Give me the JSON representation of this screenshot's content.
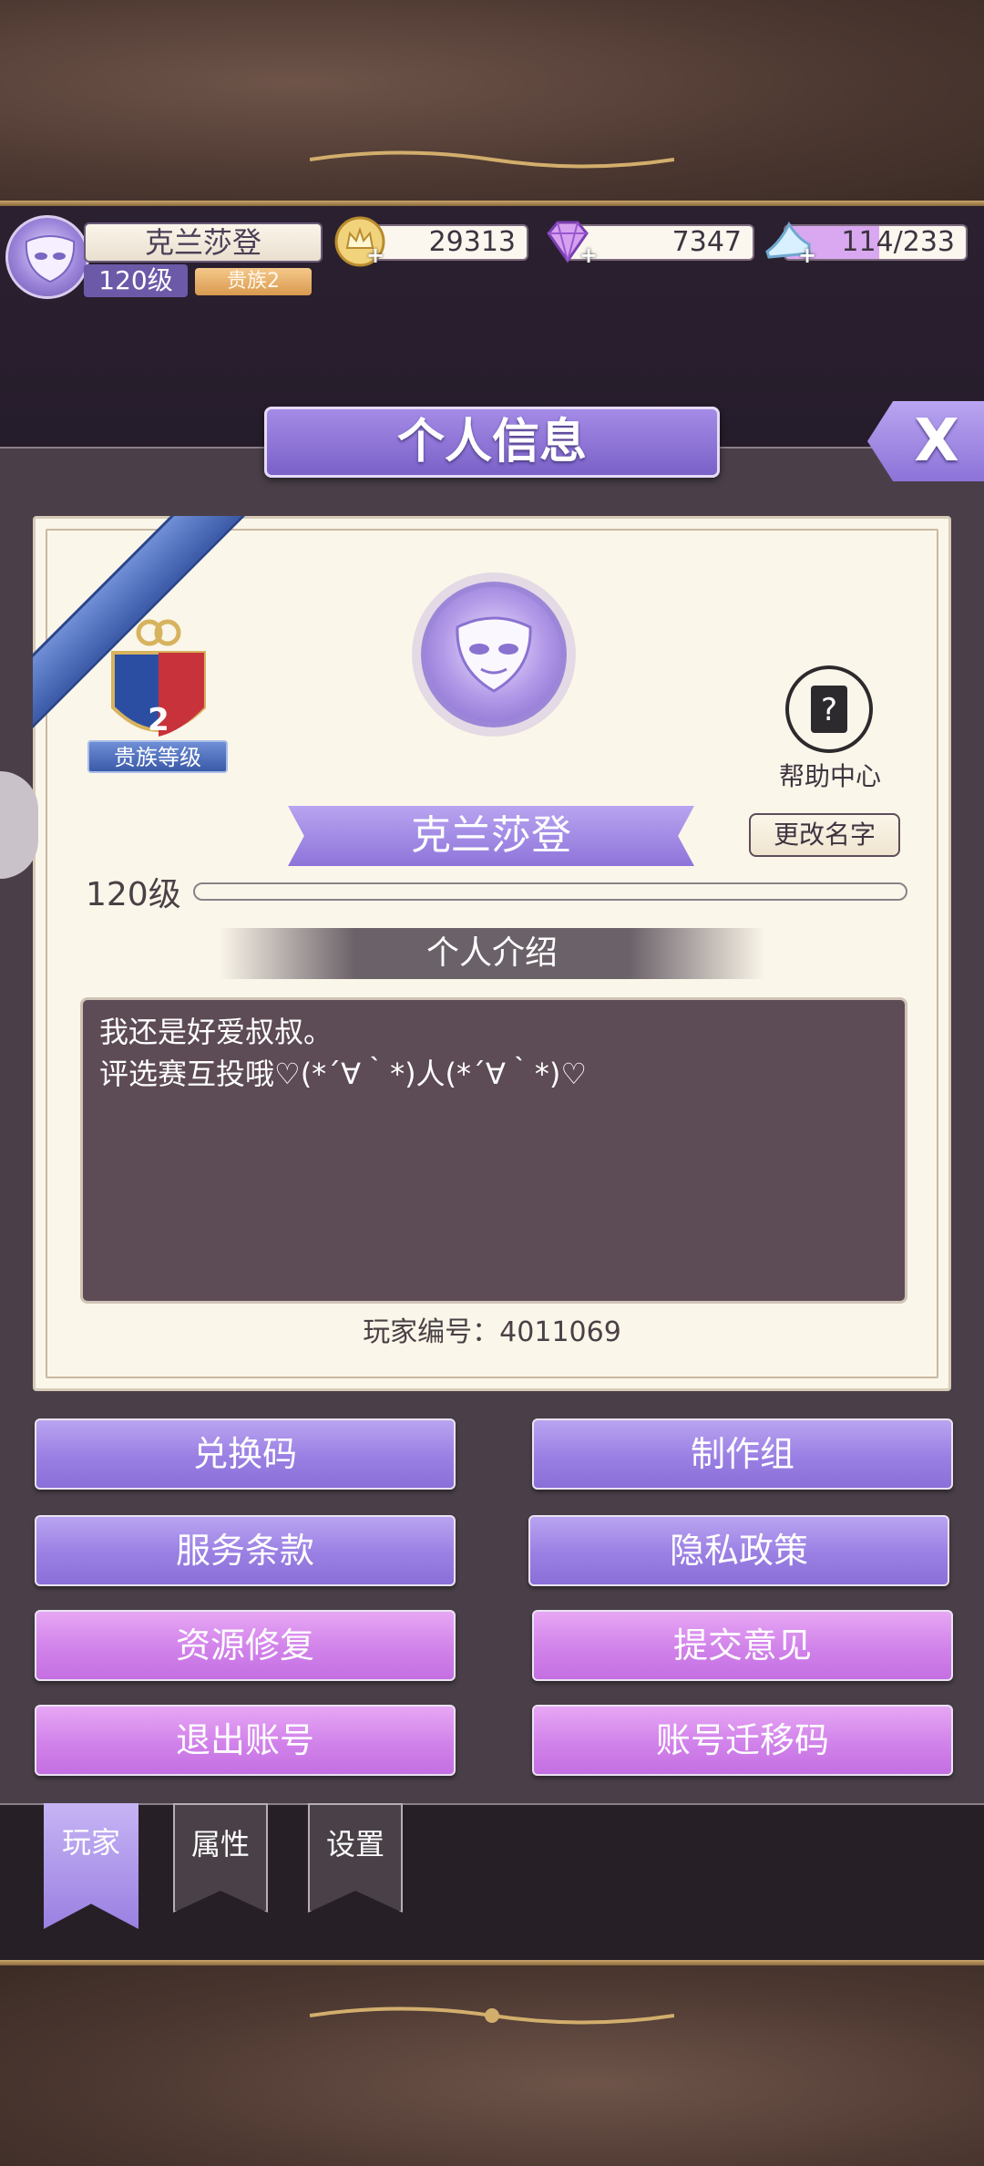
{
  "player": {
    "name": "克兰莎登",
    "level": "120级",
    "noble_badge": "贵族2"
  },
  "resources": {
    "gold": "29313",
    "diamond": "7347",
    "stamina": "114/233",
    "plus": "+"
  },
  "header": {
    "title": "个人信息",
    "close": "X"
  },
  "profile": {
    "noble_level_number": "2",
    "noble_level_label": "贵族等级",
    "help_label": "帮助中心",
    "name": "克兰莎登",
    "rename_button": "更改名字",
    "level": "120级",
    "intro_heading": "个人介绍",
    "intro_line1": "我还是好爱叔叔。",
    "intro_line2": "评选赛互投哦♡(*´∀｀*)人(*´∀｀*)♡",
    "player_id": "玩家编号：4011069"
  },
  "buttons": {
    "redeem_code": "兑换码",
    "credits": "制作组",
    "terms": "服务条款",
    "privacy": "隐私政策",
    "repair": "资源修复",
    "feedback": "提交意见",
    "logout": "退出账号",
    "migrate": "账号迁移码"
  },
  "tabs": [
    {
      "label": "玩家",
      "active": true
    },
    {
      "label": "属性",
      "active": false
    },
    {
      "label": "设置",
      "active": false
    }
  ],
  "colors": {
    "accent_violet": "#9a7fe3",
    "accent_pink": "#d182ea",
    "panel": "#4a3f48",
    "card": "#fbf6ea"
  }
}
